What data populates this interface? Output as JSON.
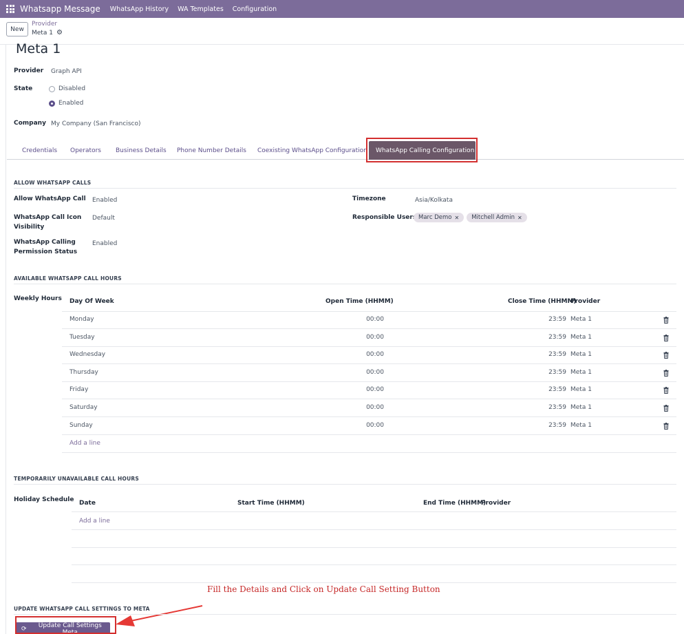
{
  "topbar": {
    "brand": "Whatsapp Message",
    "menu": [
      "WhatsApp History",
      "WA Templates",
      "Configuration"
    ]
  },
  "control_panel": {
    "new_label": "New",
    "breadcrumb_parent": "Provider",
    "breadcrumb_current": "Meta 1"
  },
  "record": {
    "title": "Meta 1",
    "provider_label": "Provider",
    "provider_value": "Graph API",
    "state_label": "State",
    "state_options": [
      "Disabled",
      "Enabled"
    ],
    "state_selected": "Enabled",
    "company_label": "Company",
    "company_value": "My Company (San Francisco)"
  },
  "tabs": [
    "Credentials",
    "Operators",
    "Business Details",
    "Phone Number Details",
    "Coexisting WhatsApp Configuration",
    "WhatsApp Calling Configuration"
  ],
  "active_tab": "WhatsApp Calling Configuration",
  "allow_calls": {
    "section_title": "ALLOW WHATSAPP CALLS",
    "allow_label": "Allow WhatsApp Call",
    "allow_value": "Enabled",
    "icon_label_line1": "WhatsApp Call Icon",
    "icon_label_line2": "Visibility",
    "icon_value": "Default",
    "perm_label_line1": "WhatsApp Calling",
    "perm_label_line2": "Permission Status",
    "perm_value": "Enabled",
    "timezone_label": "Timezone",
    "timezone_value": "Asia/Kolkata",
    "users_label": "Responsible Users",
    "users": [
      "Marc Demo",
      "Mitchell Admin"
    ]
  },
  "call_hours": {
    "section_title": "AVAILABLE WHATSAPP CALL HOURS",
    "field_label": "Weekly Hours",
    "columns": [
      "Day Of Week",
      "Open Time (HHMM)",
      "Close Time (HHMM)",
      "Provider"
    ],
    "rows": [
      {
        "day": "Monday",
        "open": "00:00",
        "close": "23:59",
        "provider": "Meta 1"
      },
      {
        "day": "Tuesday",
        "open": "00:00",
        "close": "23:59",
        "provider": "Meta 1"
      },
      {
        "day": "Wednesday",
        "open": "00:00",
        "close": "23:59",
        "provider": "Meta 1"
      },
      {
        "day": "Thursday",
        "open": "00:00",
        "close": "23:59",
        "provider": "Meta 1"
      },
      {
        "day": "Friday",
        "open": "00:00",
        "close": "23:59",
        "provider": "Meta 1"
      },
      {
        "day": "Saturday",
        "open": "00:00",
        "close": "23:59",
        "provider": "Meta 1"
      },
      {
        "day": "Sunday",
        "open": "00:00",
        "close": "23:59",
        "provider": "Meta 1"
      }
    ],
    "add_line": "Add a line"
  },
  "unavailable": {
    "section_title": "TEMPORARILY UNAVAILABLE CALL HOURS",
    "field_label": "Holiday Schedule",
    "columns": [
      "Date",
      "Start Time (HHMM)",
      "End Time (HHMM)",
      "Provider"
    ],
    "add_line": "Add a line"
  },
  "annotation": "Fill the Details and Click on Update Call Setting Button",
  "update": {
    "section_title": "UPDATE WHATSAPP CALL SETTINGS TO META",
    "button_label": "Update Call Settings Meta"
  },
  "colors": {
    "topbar": "#7c6c9a",
    "active_tab": "#6b5768",
    "highlight": "#d32f2f",
    "button": "#6b5a8e"
  }
}
